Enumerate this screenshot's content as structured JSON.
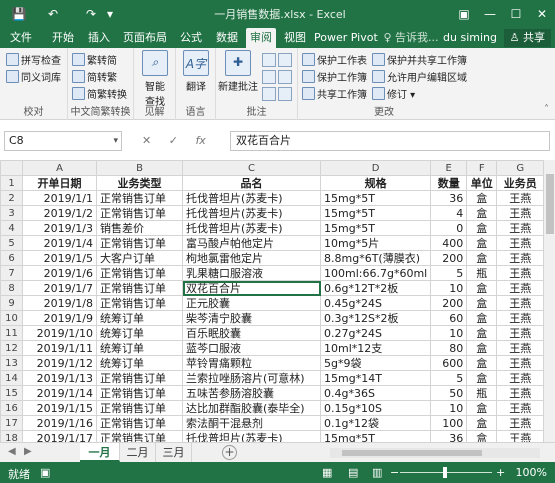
{
  "titlebar": {
    "title": "一月销售数据.xlsx - Excel",
    "save_icon": "💾",
    "undo_icon": "↶",
    "redo_icon": "↷",
    "qat_more_icon": "▾",
    "ribbon_display_icon": "▣",
    "minimize": "—",
    "maximize": "☐",
    "close": "✕"
  },
  "tabs": {
    "file": "文件",
    "home": "开始",
    "insert": "插入",
    "page_layout": "页面布局",
    "formulas": "公式",
    "data": "数据",
    "review": "审阅",
    "view": "视图",
    "power_pivot": "Power Pivot",
    "tell_me": "♀ 告诉我...",
    "user": "du siming",
    "share": "♙ 共享"
  },
  "ribbon": {
    "proofing": {
      "spell_check": "拼写检查",
      "thesaurus": "同义词库",
      "group": "校对"
    },
    "chinese_conv": {
      "to_traditional": "繁转简",
      "to_simplified": "简转繁",
      "conversion": "简繁转换",
      "group": "中文简繁转换"
    },
    "insights": {
      "smart_lookup": "智能\n查找",
      "group": "见解"
    },
    "language": {
      "translate": "翻译",
      "group": "语言"
    },
    "comments": {
      "new_comment": "新建批注",
      "group": "批注"
    },
    "changes": {
      "protect_sheet": "保护工作表",
      "protect_workbook": "保护工作簿",
      "share_workbook": "共享工作簿",
      "protect_share": "保护并共享工作簿",
      "allow_edit": "允许用户编辑区域",
      "track_changes": "修订 ▾",
      "group": "更改"
    }
  },
  "formula_bar": {
    "name_box": "C8",
    "cancel": "✕",
    "enter": "✓",
    "fx": "fx",
    "content": "双花百合片"
  },
  "sheet": {
    "columns": [
      "A",
      "B",
      "C",
      "D",
      "E",
      "F",
      "G"
    ],
    "row_numbers": [
      "1",
      "2",
      "3",
      "4",
      "5",
      "6",
      "7",
      "8",
      "9",
      "10",
      "11",
      "12",
      "13",
      "14",
      "15",
      "16",
      "17",
      "18"
    ],
    "header": [
      "开单日期",
      "业务类型",
      "品名",
      "规格",
      "数量",
      "单位",
      "业务员"
    ],
    "rows": [
      [
        "2019/1/1",
        "正常销售订单",
        "托伐普坦片(苏麦卡)",
        "15mg*5T",
        "36",
        "盒",
        "王燕"
      ],
      [
        "2019/1/2",
        "正常销售订单",
        "托伐普坦片(苏麦卡)",
        "15mg*5T",
        "4",
        "盒",
        "王燕"
      ],
      [
        "2019/1/3",
        "销售差价",
        "托伐普坦片(苏麦卡)",
        "15mg*5T",
        "0",
        "盒",
        "王燕"
      ],
      [
        "2019/1/4",
        "正常销售订单",
        "富马酸卢帕他定片",
        "10mg*5片",
        "400",
        "盒",
        "王燕"
      ],
      [
        "2019/1/5",
        "大客户订单",
        "枸地氯雷他定片",
        "8.8mg*6T(薄膜衣)",
        "200",
        "盒",
        "王燕"
      ],
      [
        "2019/1/6",
        "正常销售订单",
        "乳果糖口服溶液",
        "100ml:66.7g*60ml",
        "5",
        "瓶",
        "王燕"
      ],
      [
        "2019/1/7",
        "正常销售订单",
        "双花百合片",
        "0.6g*12T*2板",
        "10",
        "盒",
        "王燕"
      ],
      [
        "2019/1/8",
        "正常销售订单",
        "正元胶囊",
        "0.45g*24S",
        "200",
        "盒",
        "王燕"
      ],
      [
        "2019/1/9",
        "统筹订单",
        "柴芩清宁胶囊",
        "0.3g*12S*2板",
        "60",
        "盒",
        "王燕"
      ],
      [
        "2019/1/10",
        "统筹订单",
        "百乐眠胶囊",
        "0.27g*24S",
        "10",
        "盒",
        "王燕"
      ],
      [
        "2019/1/11",
        "统筹订单",
        "蓝芩口服液",
        "10ml*12支",
        "80",
        "盒",
        "王燕"
      ],
      [
        "2019/1/12",
        "统筹订单",
        "苹铃胃痛颗粒",
        "5g*9袋",
        "600",
        "盒",
        "王燕"
      ],
      [
        "2019/1/13",
        "正常销售订单",
        "兰索拉唑肠溶片(可意林)",
        "15mg*14T",
        "5",
        "盒",
        "王燕"
      ],
      [
        "2019/1/14",
        "正常销售订单",
        "五味苦参肠溶胶囊",
        "0.4g*36S",
        "50",
        "瓶",
        "王燕"
      ],
      [
        "2019/1/15",
        "正常销售订单",
        "达比加群酯胶囊(泰毕全)",
        "0.15g*10S",
        "10",
        "盒",
        "王燕"
      ],
      [
        "2019/1/16",
        "正常销售订单",
        "索法酮干混悬剂",
        "0.1g*12袋",
        "100",
        "盒",
        "王燕"
      ],
      [
        "2019/1/17",
        "正常销售订单",
        "托伐普坦片(苏麦卡)",
        "15mg*5T",
        "36",
        "盒",
        "王燕"
      ]
    ]
  },
  "sheet_tabs": {
    "prev": "◀",
    "next": "▶",
    "tabs": [
      "一月",
      "二月",
      "三月"
    ],
    "add": "+"
  },
  "status": {
    "ready": "就绪",
    "macro_icon": "▣",
    "view_normal": "▦",
    "view_layout": "▤",
    "view_break": "▥",
    "zoom_out": "−",
    "zoom_in": "+",
    "zoom": "100%"
  },
  "colors": {
    "brand": "#217346",
    "selection": "#217346"
  }
}
